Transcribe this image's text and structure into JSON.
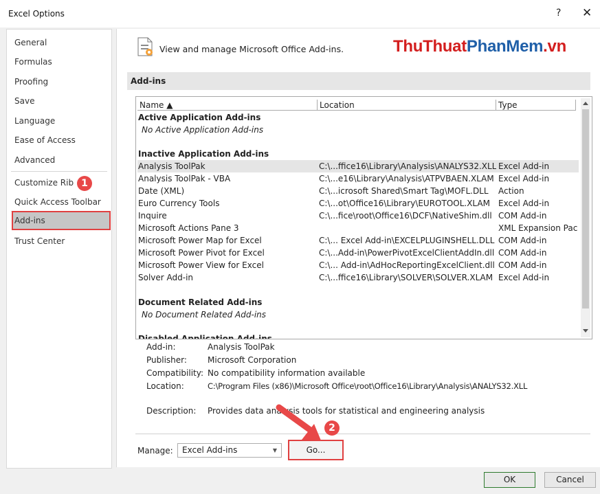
{
  "window": {
    "title": "Excel Options",
    "help_label": "?",
    "close_label": "✕"
  },
  "sidebar": {
    "items": [
      {
        "label": "General"
      },
      {
        "label": "Formulas"
      },
      {
        "label": "Proofing"
      },
      {
        "label": "Save"
      },
      {
        "label": "Language"
      },
      {
        "label": "Ease of Access"
      },
      {
        "label": "Advanced"
      },
      {
        "label": "Customize Rib"
      },
      {
        "label": "Quick Access Toolbar"
      },
      {
        "label": "Add-ins",
        "selected": true
      },
      {
        "label": "Trust Center"
      }
    ]
  },
  "callouts": {
    "one": "1",
    "two": "2"
  },
  "header": {
    "text": "View and manage Microsoft Office Add-ins.",
    "brand_part1": "ThuThuat",
    "brand_part2": "PhanMem",
    "brand_part3": ".vn"
  },
  "section_title": "Add-ins",
  "columns": {
    "name": "Name ▲",
    "location": "Location",
    "type": "Type"
  },
  "groups": {
    "active": {
      "title": "Active Application Add-ins",
      "empty": "No Active Application Add-ins"
    },
    "inactive": {
      "title": "Inactive Application Add-ins"
    },
    "document": {
      "title": "Document Related Add-ins",
      "empty": "No Document Related Add-ins"
    },
    "disabled": {
      "title": "Disabled Application Add-ins"
    }
  },
  "inactive_rows": [
    {
      "name": "Analysis ToolPak",
      "location": "C:\\...ffice16\\Library\\Analysis\\ANALYS32.XLL",
      "type": "Excel Add-in"
    },
    {
      "name": "Analysis ToolPak - VBA",
      "location": "C:\\...e16\\Library\\Analysis\\ATPVBAEN.XLAM",
      "type": "Excel Add-in"
    },
    {
      "name": "Date (XML)",
      "location": "C:\\...icrosoft Shared\\Smart Tag\\MOFL.DLL",
      "type": "Action"
    },
    {
      "name": "Euro Currency Tools",
      "location": "C:\\...ot\\Office16\\Library\\EUROTOOL.XLAM",
      "type": "Excel Add-in"
    },
    {
      "name": "Inquire",
      "location": "C:\\...fice\\root\\Office16\\DCF\\NativeShim.dll",
      "type": "COM Add-in"
    },
    {
      "name": "Microsoft Actions Pane 3",
      "location": "",
      "type": "XML Expansion Pack"
    },
    {
      "name": "Microsoft Power Map for Excel",
      "location": "C:\\... Excel Add-in\\EXCELPLUGINSHELL.DLL",
      "type": "COM Add-in"
    },
    {
      "name": "Microsoft Power Pivot for Excel",
      "location": "C:\\...Add-in\\PowerPivotExcelClientAddIn.dll",
      "type": "COM Add-in"
    },
    {
      "name": "Microsoft Power View for Excel",
      "location": "C:\\... Add-in\\AdHocReportingExcelClient.dll",
      "type": "COM Add-in"
    },
    {
      "name": "Solver Add-in",
      "location": "C:\\...ffice16\\Library\\SOLVER\\SOLVER.XLAM",
      "type": "Excel Add-in"
    }
  ],
  "details": {
    "addin_label": "Add-in:",
    "addin_value": "Analysis ToolPak",
    "publisher_label": "Publisher:",
    "publisher_value": "Microsoft Corporation",
    "compat_label": "Compatibility:",
    "compat_value": "No compatibility information available",
    "location_label": "Location:",
    "location_value": "C:\\Program Files (x86)\\Microsoft Office\\root\\Office16\\Library\\Analysis\\ANALYS32.XLL",
    "description_label": "Description:",
    "description_value": "Provides data analysis tools for statistical and engineering analysis"
  },
  "manage": {
    "label": "Manage:",
    "selected": "Excel Add-ins",
    "go_label": "Go..."
  },
  "footer": {
    "ok_label": "OK",
    "cancel_label": "Cancel"
  },
  "colors": {
    "accent_red": "#e04040",
    "brand_red": "#d31e1e",
    "brand_blue": "#1f5fa8",
    "selected_row": "#e5e5e5"
  }
}
